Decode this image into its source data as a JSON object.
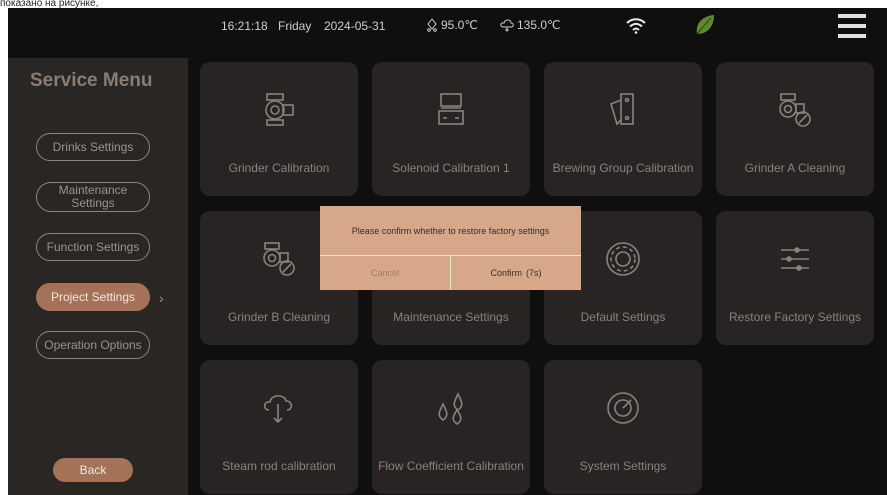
{
  "caption": "показано на рисунке,",
  "status": {
    "time": "16:21:18",
    "day": "Friday",
    "date": "2024-05-31",
    "temp1": "95.0℃",
    "temp2": "135.0℃"
  },
  "sidebar": {
    "title": "Service Menu",
    "items": [
      {
        "label": "Drinks Settings"
      },
      {
        "label": "Maintenance Settings"
      },
      {
        "label": "Function Settings"
      },
      {
        "label": "Project Settings"
      },
      {
        "label": "Operation Options"
      }
    ],
    "active_index": 3,
    "back_label": "Back"
  },
  "tiles": [
    {
      "label": "Grinder Calibration",
      "icon": "grinder-icon"
    },
    {
      "label": "Solenoid Calibration 1",
      "icon": "solenoid-icon"
    },
    {
      "label": "Brewing Group Calibration",
      "icon": "brewing-group-icon"
    },
    {
      "label": "Grinder A Cleaning",
      "icon": "grinder-cleaning-icon"
    },
    {
      "label": "Grinder B Cleaning",
      "icon": "grinder-cleaning-icon"
    },
    {
      "label": "Maintenance Settings",
      "icon": "maintenance-icon"
    },
    {
      "label": "Default Settings",
      "icon": "gear-icon"
    },
    {
      "label": "Restore Factory Settings",
      "icon": "sliders-icon"
    },
    {
      "label": "Steam rod calibration",
      "icon": "steam-icon"
    },
    {
      "label": "Flow Coefficient Calibration",
      "icon": "water-drops-icon"
    },
    {
      "label": "System Settings",
      "icon": "target-icon"
    }
  ],
  "modal": {
    "message": "Please confirm whether to restore factory settings",
    "cancel_label": "Cancel",
    "confirm_label": "Confirm",
    "countdown": "(7s)"
  },
  "colors": {
    "accent": "#a57157",
    "modal_bg": "#d6a889",
    "leaf": "#5c8a2c"
  }
}
